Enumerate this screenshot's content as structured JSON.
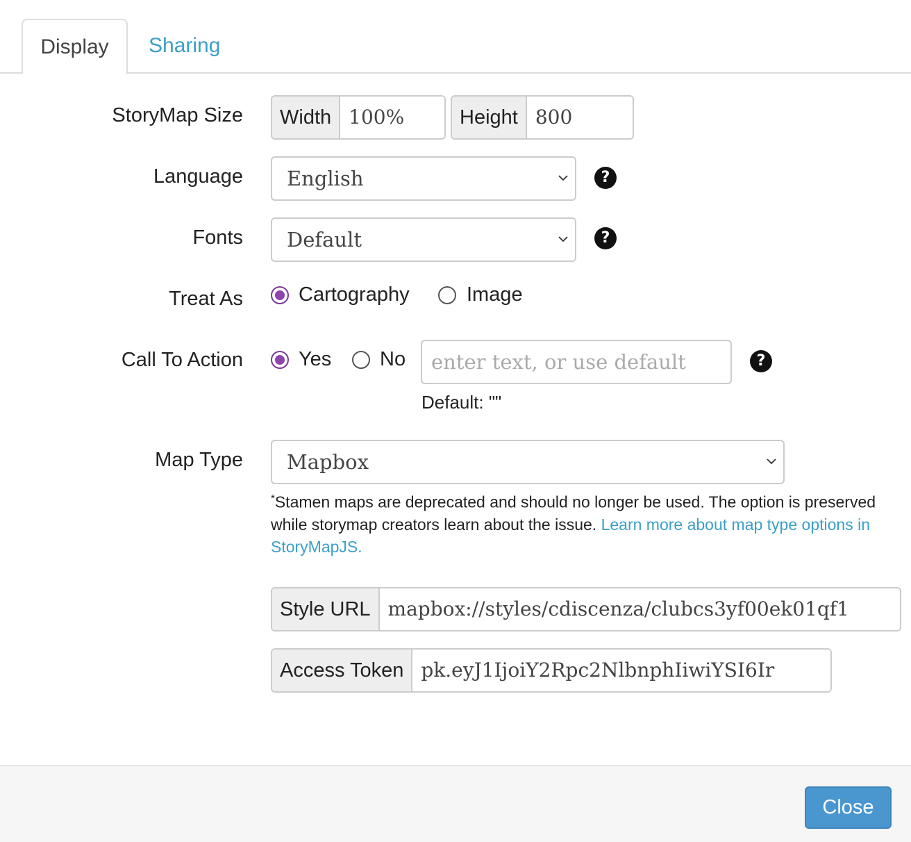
{
  "tabs": [
    {
      "label": "Display",
      "active": true
    },
    {
      "label": "Sharing",
      "active": false
    }
  ],
  "form": {
    "size": {
      "label": "StoryMap Size",
      "width_label": "Width",
      "width_value": "100%",
      "height_label": "Height",
      "height_value": "800"
    },
    "language": {
      "label": "Language",
      "value": "English"
    },
    "fonts": {
      "label": "Fonts",
      "value": "Default"
    },
    "treat_as": {
      "label": "Treat As",
      "options": [
        {
          "label": "Cartography",
          "checked": true
        },
        {
          "label": "Image",
          "checked": false
        }
      ]
    },
    "call_to_action": {
      "label": "Call To Action",
      "options": [
        {
          "label": "Yes",
          "checked": true
        },
        {
          "label": "No",
          "checked": false
        }
      ],
      "placeholder": "enter text, or use default",
      "default_text": "Default: \"\""
    },
    "map_type": {
      "label": "Map Type",
      "value": "Mapbox",
      "note_marker": "*",
      "note_text": "Stamen maps are deprecated and should no longer be used. The option is preserved while storymap creators learn about the issue. ",
      "note_link": "Learn more about map type options in StoryMapJS."
    },
    "style_url": {
      "label": "Style URL",
      "value": "mapbox://styles/cdiscenza/clubcs3yf00ek01qf1"
    },
    "access_token": {
      "label": "Access Token",
      "value": "pk.eyJ1IjoiY2Rpc2NlbnphIiwiYSI6Ir"
    }
  },
  "footer": {
    "close_label": "Close"
  },
  "colors": {
    "accent_link": "#3aa0c9",
    "radio_checked": "#8e44ad",
    "primary_button": "#4a97d0"
  },
  "icons": {
    "help": "question-circle-icon",
    "select": "chevron-down-icon"
  }
}
